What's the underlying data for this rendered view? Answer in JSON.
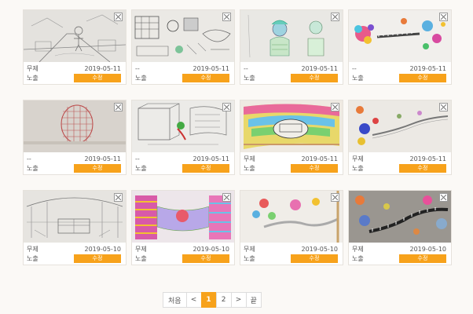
{
  "gallery": {
    "items": [
      {
        "title": "무제",
        "date": "2019-05-11",
        "status": "노출",
        "edit_label": "수정",
        "thumb": "pencil-street-drawing"
      },
      {
        "title": "--",
        "date": "2019-05-11",
        "status": "노출",
        "edit_label": "수정",
        "thumb": "school-sketch-drawing"
      },
      {
        "title": "--",
        "date": "2019-05-11",
        "status": "노출",
        "edit_label": "수정",
        "thumb": "portrait-drawing"
      },
      {
        "title": "--",
        "date": "2019-05-11",
        "status": "노출",
        "edit_label": "수정",
        "thumb": "space-track-drawing"
      },
      {
        "title": "--",
        "date": "2019-05-11",
        "status": "노출",
        "edit_label": "수정",
        "thumb": "red-grid-drawing"
      },
      {
        "title": "--",
        "date": "2019-05-11",
        "status": "노출",
        "edit_label": "수정",
        "thumb": "room-sketch-drawing"
      },
      {
        "title": "무제",
        "date": "2019-05-11",
        "status": "노출",
        "edit_label": "수정",
        "thumb": "colorful-tunnel-drawing"
      },
      {
        "title": "무제",
        "date": "2019-05-11",
        "status": "노출",
        "edit_label": "수정",
        "thumb": "planets-track-drawing"
      },
      {
        "title": "무제",
        "date": "2019-05-10",
        "status": "노출",
        "edit_label": "수정",
        "thumb": "interior-sketch-drawing"
      },
      {
        "title": "무제",
        "date": "2019-05-10",
        "status": "노출",
        "edit_label": "수정",
        "thumb": "purple-city-drawing"
      },
      {
        "title": "무제",
        "date": "2019-05-10",
        "status": "노출",
        "edit_label": "수정",
        "thumb": "flowers-path-drawing"
      },
      {
        "title": "무제",
        "date": "2019-05-10",
        "status": "노출",
        "edit_label": "수정",
        "thumb": "dark-space-drawing"
      }
    ]
  },
  "pagination": {
    "first": "처음",
    "prev": "<",
    "pages": [
      "1",
      "2"
    ],
    "current": "1",
    "next": ">",
    "last": "끝"
  },
  "colors": {
    "accent": "#f7a21b",
    "background": "#fbf9f6"
  }
}
